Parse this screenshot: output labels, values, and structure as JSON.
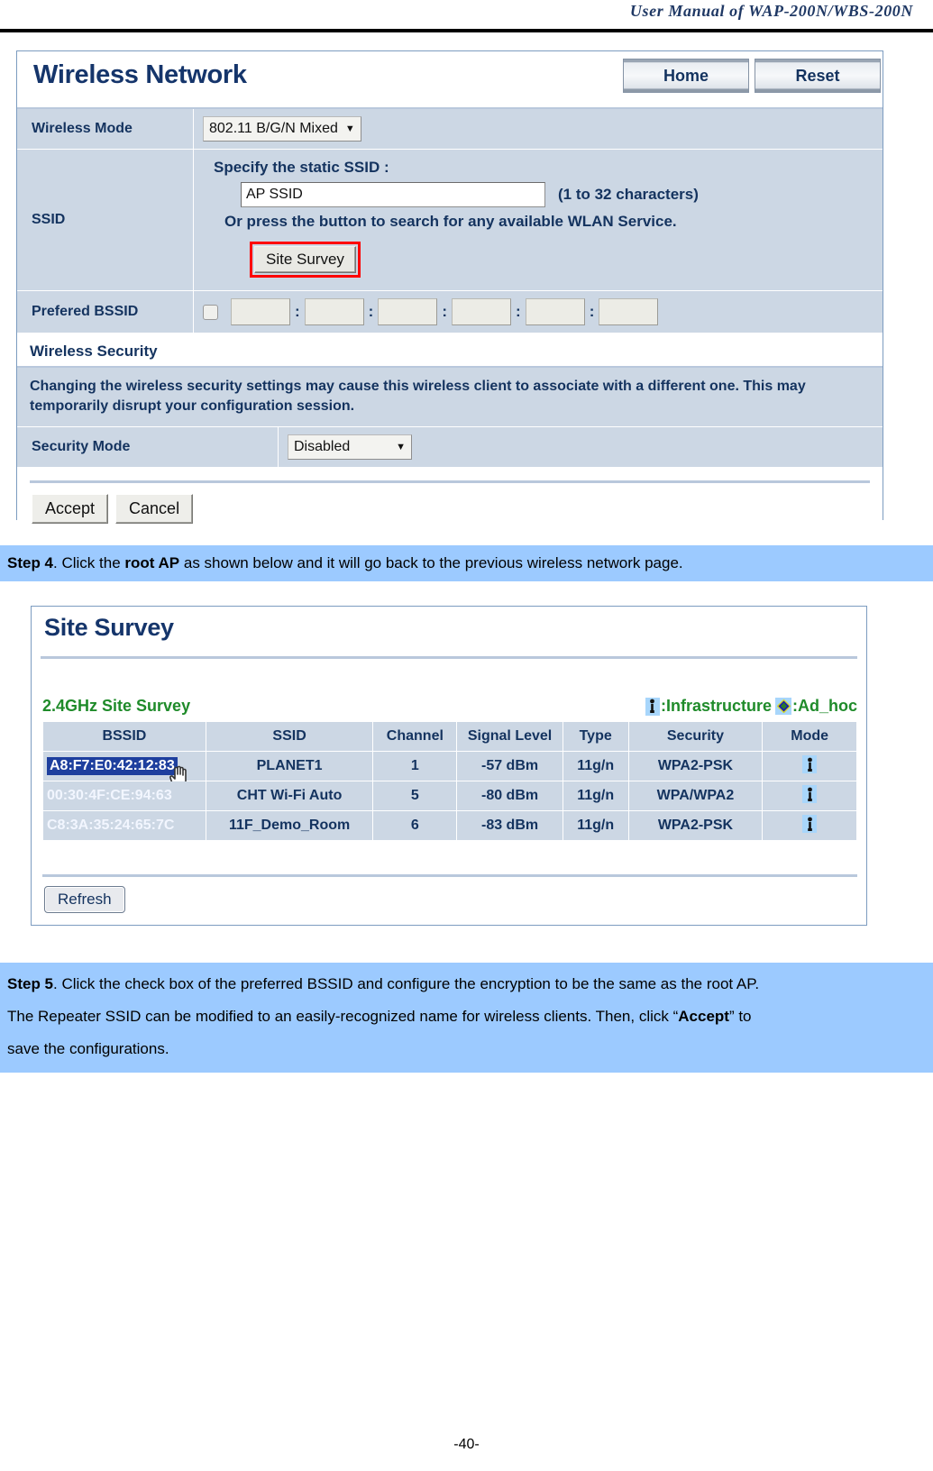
{
  "document": {
    "header_title": "User Manual of WAP-200N/WBS-200N",
    "page_number": "-40-"
  },
  "wireless_network": {
    "title": "Wireless Network",
    "home_button": "Home",
    "reset_button": "Reset",
    "wireless_mode_label": "Wireless Mode",
    "wireless_mode_value": "802.11 B/G/N Mixed",
    "ssid_label": "SSID",
    "ssid_specify_text": "Specify the static SSID  :",
    "ssid_value": "AP SSID",
    "ssid_hint": "(1 to 32 characters)",
    "ssid_or_text": "Or press the button to search for any available WLAN Service.",
    "site_survey_button": "Site Survey",
    "prefered_bssid_label": "Prefered BSSID",
    "bssid_octets": [
      "",
      "",
      "",
      "",
      "",
      ""
    ],
    "bssid_separator": ":",
    "wireless_security_heading": "Wireless Security",
    "security_notice": "Changing the wireless security settings may cause this wireless client to associate with a different one. This may temporarily disrupt your configuration session.",
    "security_mode_label": "Security Mode",
    "security_mode_value": "Disabled",
    "accept_button": "Accept",
    "cancel_button": "Cancel"
  },
  "step4": {
    "prefix": "Step 4",
    "text_a": ". Click the ",
    "bold": "root AP",
    "text_b": " as shown below and it will go back to the previous wireless network page."
  },
  "site_survey": {
    "title": "Site Survey",
    "subtitle": "2.4GHz Site Survey",
    "legend": [
      {
        "icon": "infrastructure-icon",
        "label": ":Infrastructure"
      },
      {
        "icon": "adhoc-icon",
        "label": ":Ad_hoc"
      }
    ],
    "columns": [
      "BSSID",
      "SSID",
      "Channel",
      "Signal Level",
      "Type",
      "Security",
      "Mode"
    ],
    "rows": [
      {
        "bssid": "A8:F7:E0:42:12:83",
        "selected": true,
        "ssid": "PLANET1",
        "channel": "1",
        "signal_level": "-57 dBm",
        "type": "11g/n",
        "security": "WPA2-PSK",
        "mode": "infrastructure-icon"
      },
      {
        "bssid": "00:30:4F:CE:94:63",
        "selected": false,
        "ssid": "CHT Wi-Fi Auto",
        "channel": "5",
        "signal_level": "-80 dBm",
        "type": "11g/n",
        "security": "WPA/WPA2",
        "mode": "infrastructure-icon"
      },
      {
        "bssid": "C8:3A:35:24:65:7C",
        "selected": false,
        "ssid": "11F_Demo_Room",
        "channel": "6",
        "signal_level": "-83 dBm",
        "type": "11g/n",
        "security": "WPA2-PSK",
        "mode": "infrastructure-icon"
      }
    ],
    "refresh_button": "Refresh"
  },
  "step5": {
    "prefix": "Step 5",
    "line1_a": ". Click the check box of the preferred BSSID and configure the encryption to be the same as the root AP.",
    "line2_a": "The Repeater SSID can be modified to an easily-recognized name for wireless clients. Then, click “",
    "line2_bold": "Accept",
    "line2_b": "” to",
    "line3": "save the configurations."
  },
  "colors": {
    "accent_blue": "#14335f",
    "band_blue": "#9ccaff",
    "row_blue": "#ccd7e4",
    "green": "#1f8b2a",
    "highlight_red": "#ff0000",
    "selection_blue": "#1e3f9e"
  }
}
